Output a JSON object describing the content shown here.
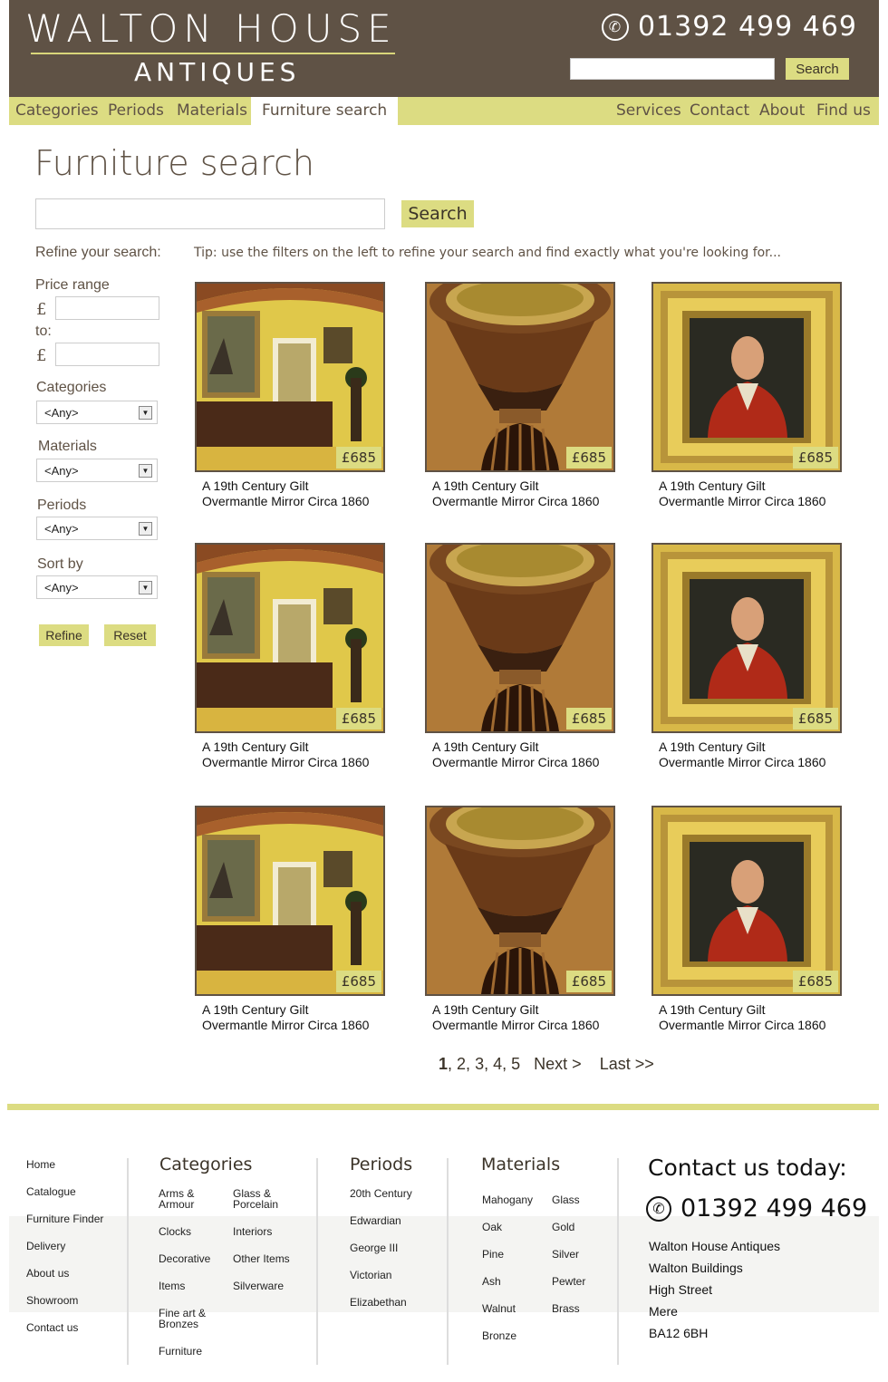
{
  "brand": {
    "line1": "WALTON HOUSE",
    "line2": "ANTIQUES",
    "phone": "01392 499 469"
  },
  "header_search": {
    "button": "Search",
    "placeholder": ""
  },
  "nav_left": [
    "Categories",
    "Periods",
    "Materials",
    "Furniture search"
  ],
  "nav_right": [
    "Services",
    "Contact",
    "About",
    "Find us"
  ],
  "main": {
    "title": "Furniture search",
    "search_button": "Search",
    "refine_label": "Refine your search:",
    "tip": "Tip: use the filters on the left to refine your search and find exactly what you're looking for..."
  },
  "filters": {
    "price_range": "Price range",
    "currency": "£",
    "to": "to:",
    "categories": "Categories",
    "materials": "Materials",
    "periods": "Periods",
    "sort_by": "Sort by",
    "any": "<Any>",
    "refine_button": "Refine",
    "reset_button": "Reset"
  },
  "products": [
    {
      "title_line1": "A 19th Century Gilt",
      "title_line2": "Overmantle Mirror Circa 1860",
      "price": "£685",
      "image": "mirror"
    },
    {
      "title_line1": "A 19th Century Gilt",
      "title_line2": "Overmantle Mirror Circa 1860",
      "price": "£685",
      "image": "urn"
    },
    {
      "title_line1": "A 19th Century Gilt",
      "title_line2": "Overmantle Mirror Circa 1860",
      "price": "£685",
      "image": "portrait"
    },
    {
      "title_line1": "A 19th Century Gilt",
      "title_line2": "Overmantle Mirror Circa 1860",
      "price": "£685",
      "image": "mirror"
    },
    {
      "title_line1": "A 19th Century Gilt",
      "title_line2": "Overmantle Mirror Circa 1860",
      "price": "£685",
      "image": "urn"
    },
    {
      "title_line1": "A 19th Century Gilt",
      "title_line2": "Overmantle Mirror Circa 1860",
      "price": "£685",
      "image": "portrait"
    },
    {
      "title_line1": "A 19th Century Gilt",
      "title_line2": "Overmantle Mirror Circa 1860",
      "price": "£685",
      "image": "mirror"
    },
    {
      "title_line1": "A 19th Century Gilt",
      "title_line2": "Overmantle Mirror Circa 1860",
      "price": "£685",
      "image": "urn"
    },
    {
      "title_line1": "A 19th Century Gilt",
      "title_line2": "Overmantle Mirror Circa 1860",
      "price": "£685",
      "image": "portrait"
    }
  ],
  "pager": {
    "current": "1",
    "p2": "2",
    "p3": "3",
    "p4": "4",
    "p5": "5",
    "next": "Next >",
    "last": "Last >>"
  },
  "footer": {
    "links": [
      "Home",
      "Catalogue",
      "Furniture Finder",
      "Delivery",
      "About us",
      "Showroom",
      "Contact us"
    ],
    "categories_title": "Categories",
    "categories": [
      "Arms & Armour",
      "Glass & Porcelain",
      "Clocks",
      "Interiors",
      "Decorative",
      "Other Items",
      "Items",
      "Silverware",
      "Fine art & Bronzes",
      "Furniture"
    ],
    "periods_title": "Periods",
    "periods": [
      "20th Century",
      "Edwardian",
      "George III",
      "Victorian",
      "Elizabethan"
    ],
    "materials_title": "Materials",
    "materials": [
      "Mahogany",
      "Glass",
      "Oak",
      "Gold",
      "Pine",
      "Silver",
      "Ash",
      "Pewter",
      "Walnut",
      "Brass",
      "Bronze"
    ],
    "contact_title": "Contact us today:",
    "phone": "01392 499 469",
    "address": [
      "Walton House Antiques",
      "Walton Buildings",
      "High Street",
      "Mere",
      "BA12 6BH"
    ]
  },
  "colors": {
    "brown": "#5f5245",
    "lime": "#dcdc82"
  }
}
